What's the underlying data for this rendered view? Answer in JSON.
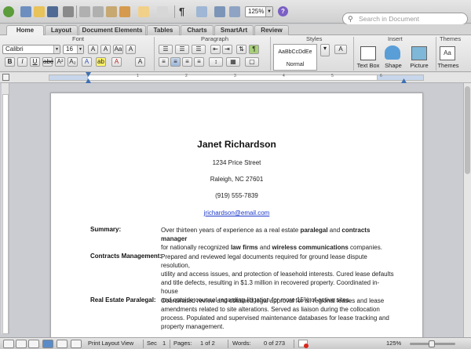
{
  "toolbar": {
    "zoom": "125%",
    "search_placeholder": "Search in Document"
  },
  "ribbon_tabs": [
    "Home",
    "Layout",
    "Document Elements",
    "Tables",
    "Charts",
    "SmartArt",
    "Review"
  ],
  "ribbon": {
    "groups": {
      "font": "Font",
      "paragraph": "Paragraph",
      "styles": "Styles",
      "insert": "Insert",
      "themes": "Themes"
    },
    "font_name": "Calibri",
    "font_size": "16",
    "style_sample": "AaBbCcDdEe",
    "style_name": "Normal",
    "insert": {
      "text_box": "Text Box",
      "shape": "Shape",
      "picture": "Picture"
    },
    "themes_label": "Themes"
  },
  "ruler": {
    "numbers": [
      "1",
      "2",
      "3",
      "4",
      "5",
      "6"
    ]
  },
  "document": {
    "name": "Janet Richardson",
    "address1": "1234 Price Street",
    "address2": "Raleigh, NC 27601",
    "phone": "(919) 555-7839",
    "email": "jrichardson@email.com",
    "sections": [
      {
        "label": "Summary:",
        "lines": [
          [
            "Over thirteen years of experience as a real estate ",
            {
              "b": "paralegal"
            },
            " and ",
            {
              "b": "contracts manager"
            }
          ],
          [
            "for nationally recognized ",
            {
              "b": "law firms"
            },
            " and ",
            {
              "b": "wireless communications"
            },
            " companies."
          ]
        ]
      },
      {
        "label": "Contracts Management:",
        "lines": [
          [
            "Prepared and reviewed legal documents required for ground lease dispute resolution,"
          ],
          [
            "utility and access issues, and protection of leasehold interests. Cured lease defaults"
          ],
          [
            "and title defects, resulting in $1.3 million in recovered property. Coordinated in-house"
          ],
          [
            "and outside counsel regarding litigation for more 15% of active sites."
          ]
        ]
      },
      {
        "label": "Real Estate Paralegal:",
        "lines": [
          [
            "Coordinated review and obtained legal approval for all regional leases and lease"
          ],
          [
            "amendments related to site alterations. Served as liaison during the collocation"
          ],
          [
            "process. Populated and supervised maintenance databases for lease tracking and"
          ],
          [
            "property management."
          ]
        ]
      }
    ]
  },
  "statusbar": {
    "view": "Print Layout View",
    "sec_label": "Sec",
    "sec_value": "1",
    "pages_label": "Pages:",
    "pages_value": "1 of 2",
    "words_label": "Words:",
    "words_value": "0 of 273",
    "zoom": "125%"
  }
}
